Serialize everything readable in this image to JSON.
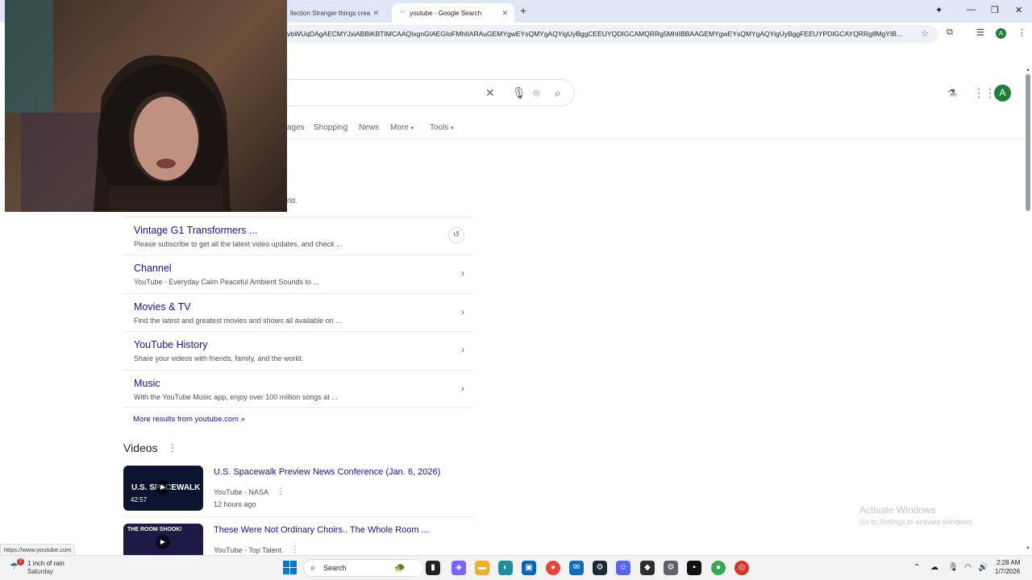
{
  "browser": {
    "tabs": [
      {
        "label": "llection Stranger things crea",
        "active": false
      },
      {
        "label": "youtube - Google Search",
        "active": true
      }
    ],
    "url": "vbWUqDAgAECMYJxiABBiKBTIMCAAQIxgnGIAEGIoFMhIIARAuGEMYgwEYsQMYgAQYigUyBggCEEUYQDIGCAMQRRg5MhIIBBAAGEMYgwEYsQMYgAQYigUyBggFEEUYPDIGCAYQRRg8MgYIB...",
    "profile_initial": "A"
  },
  "google": {
    "nav_tabs": [
      "ages",
      "Shopping",
      "News",
      "More",
      "Tools"
    ],
    "avatar_initial": "A"
  },
  "result": {
    "partial_snippet": "rld.",
    "sitelinks": [
      {
        "title": "Vintage G1 Transformers ...",
        "desc": "Please subscribe to get all the latest video updates, and check ..."
      },
      {
        "title": "Channel",
        "desc": "YouTube · Everyday Calm Peaceful Ambient Sounds to ..."
      },
      {
        "title": "Movies & TV",
        "desc": "Find the latest and greatest movies and shows all available on ..."
      },
      {
        "title": "YouTube History",
        "desc": "Share your videos with friends, family, and the world."
      },
      {
        "title": "Music",
        "desc": "With the YouTube Music app, enjoy over 100 million songs at ..."
      }
    ],
    "more_results": "More results from youtube.com »"
  },
  "videos": {
    "heading": "Videos",
    "items": [
      {
        "title": "U.S. Spacewalk Preview News Conference (Jan. 6, 2026)",
        "source": "YouTube · NASA",
        "time": "12 hours ago",
        "thumb_text": "U.S. SPACEWALK",
        "duration": "42:57"
      },
      {
        "title": "These Were Not Ordinary Choirs.. The Whole Room ...",
        "source": "YouTube · Top Talent",
        "time": "",
        "thumb_text": "THE ROOM SHOOK!",
        "duration": ""
      }
    ]
  },
  "watermark": {
    "title": "Activate Windows",
    "subtitle": "Go to Settings to activate Windows."
  },
  "status_url": "https://www.youtube.com",
  "taskbar": {
    "weather_badge": "2",
    "weather_line1": "1 inch of rain",
    "weather_line2": "Saturday",
    "search_label": "Search",
    "time": "2:28 AM",
    "date": "1/7/2026"
  },
  "colors": {
    "link": "#1a0dab",
    "avatar": "#188038",
    "tabstrip": "#dfe7f6"
  }
}
